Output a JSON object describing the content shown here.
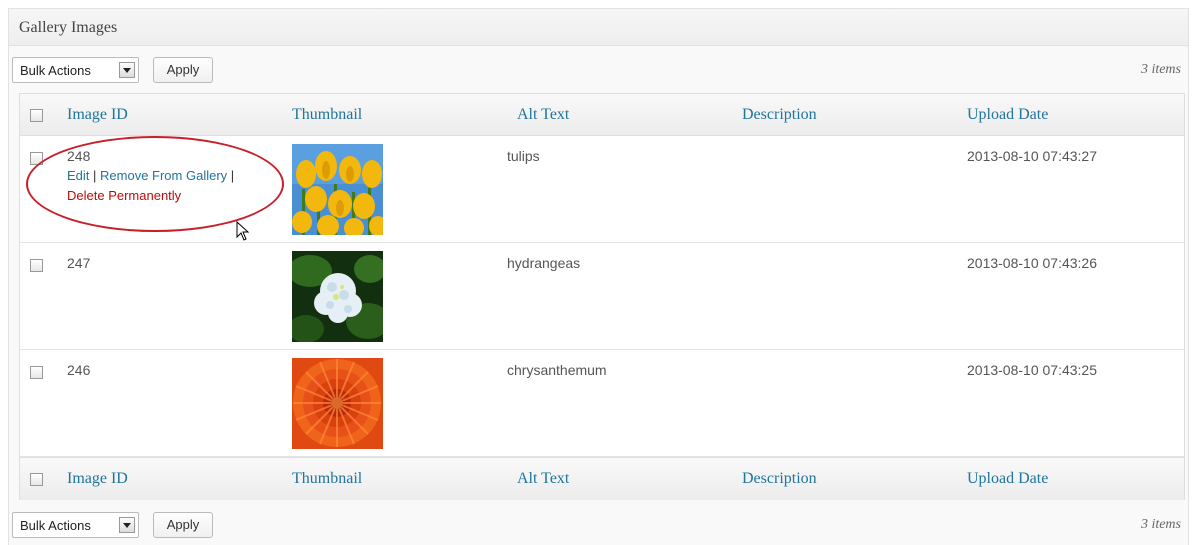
{
  "panel": {
    "title": "Gallery Images"
  },
  "nav_top": {
    "bulk_label": "Bulk Actions",
    "apply_label": "Apply",
    "count": "3 items"
  },
  "nav_bottom": {
    "bulk_label": "Bulk Actions",
    "apply_label": "Apply",
    "count": "3 items"
  },
  "columns": [
    "Image ID",
    "Thumbnail",
    "Alt Text",
    "Description",
    "Upload Date"
  ],
  "rows": [
    {
      "id": "248",
      "alt": "tulips",
      "description": "",
      "date": "2013-08-10 07:43:27",
      "thumb": "tulips-photo",
      "actions": {
        "edit": "Edit",
        "sep1": " | ",
        "remove": "Remove From Gallery",
        "sep2": " |",
        "delete": "Delete Permanently"
      }
    },
    {
      "id": "247",
      "alt": "hydrangeas",
      "description": "",
      "date": "2013-08-10 07:43:26",
      "thumb": "hydrangeas-photo"
    },
    {
      "id": "246",
      "alt": "chrysanthemum",
      "description": "",
      "date": "2013-08-10 07:43:25",
      "thumb": "chrysanthemum-photo"
    }
  ],
  "colors": {
    "link": "#21759b",
    "delete": "#bc0b0b",
    "annotation": "#c8202a"
  }
}
